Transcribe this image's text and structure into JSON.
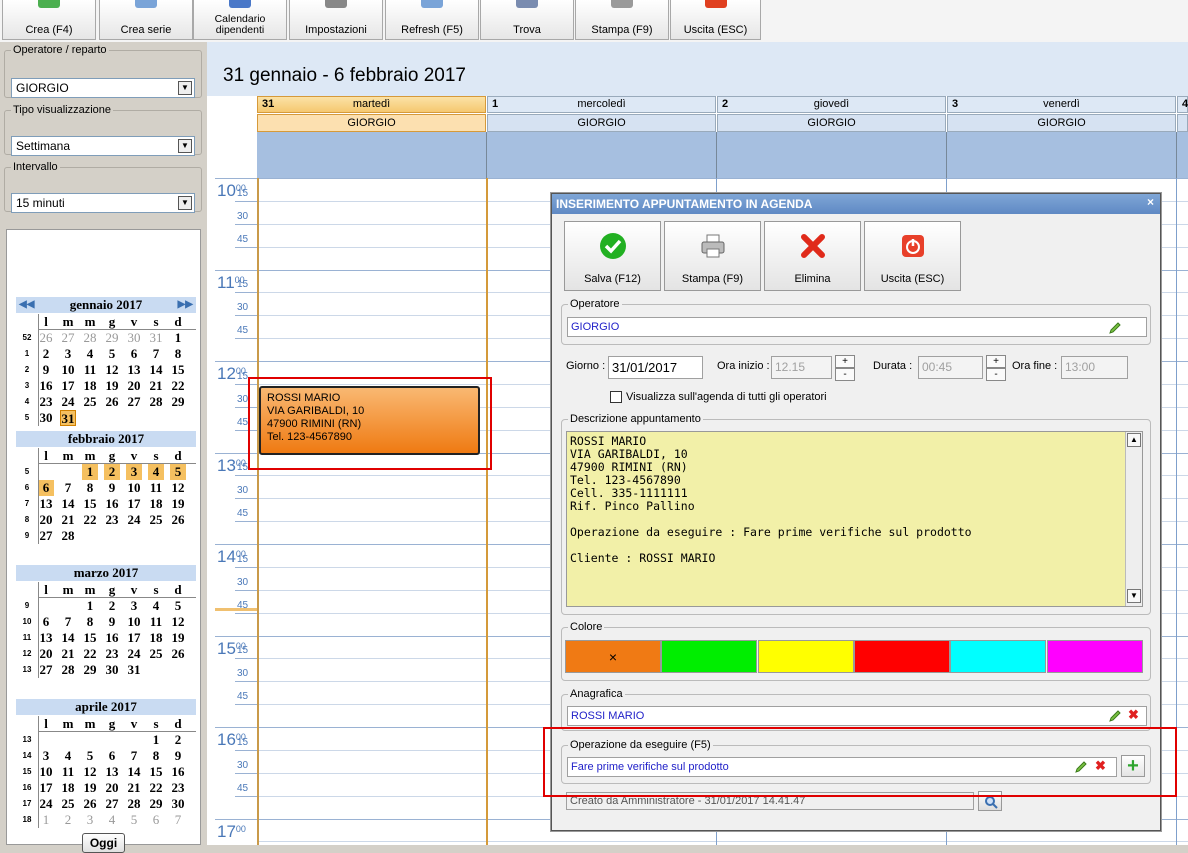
{
  "toolbar": {
    "buttons": [
      {
        "label": "Crea (F4)",
        "color": "#4caf50"
      },
      {
        "label": "Crea serie",
        "color": "#7aa4d8"
      },
      {
        "label": "Calendario dipendenti",
        "color": "#4a78c8"
      },
      {
        "label": "Impostazioni",
        "color": "#888888"
      },
      {
        "label": "Refresh (F5)",
        "color": "#7aa4d8"
      },
      {
        "label": "Trova",
        "color": "#7a8cb0"
      },
      {
        "label": "Stampa (F9)",
        "color": "#9a9a9a"
      },
      {
        "label": "Uscita (ESC)",
        "color": "#e04020"
      }
    ]
  },
  "left": {
    "operatore_label": "Operatore / reparto",
    "operatore_value": "GIORGIO",
    "tipo_label": "Tipo visualizzazione",
    "tipo_value": "Settimana",
    "intervallo_label": "Intervallo",
    "intervallo_value": "15 minuti",
    "dow": [
      "l",
      "m",
      "m",
      "g",
      "v",
      "s",
      "d"
    ],
    "months": [
      {
        "title": "gennaio 2017",
        "nav": true,
        "rows": [
          {
            "wk": "52",
            "days": [
              [
                "26",
                "g"
              ],
              [
                "27",
                "g"
              ],
              [
                "28",
                "g"
              ],
              [
                "29",
                "g"
              ],
              [
                "30",
                "g"
              ],
              [
                "31",
                "g"
              ],
              [
                "1",
                ""
              ]
            ]
          },
          {
            "wk": "1",
            "days": [
              [
                "2",
                ""
              ],
              [
                "3",
                ""
              ],
              [
                "4",
                ""
              ],
              [
                "5",
                ""
              ],
              [
                "6",
                ""
              ],
              [
                "7",
                ""
              ],
              [
                "8",
                ""
              ]
            ]
          },
          {
            "wk": "2",
            "days": [
              [
                "9",
                ""
              ],
              [
                "10",
                ""
              ],
              [
                "11",
                ""
              ],
              [
                "12",
                ""
              ],
              [
                "13",
                ""
              ],
              [
                "14",
                ""
              ],
              [
                "15",
                ""
              ]
            ]
          },
          {
            "wk": "3",
            "days": [
              [
                "16",
                ""
              ],
              [
                "17",
                ""
              ],
              [
                "18",
                ""
              ],
              [
                "19",
                ""
              ],
              [
                "20",
                ""
              ],
              [
                "21",
                ""
              ],
              [
                "22",
                ""
              ]
            ]
          },
          {
            "wk": "4",
            "days": [
              [
                "23",
                ""
              ],
              [
                "24",
                ""
              ],
              [
                "25",
                ""
              ],
              [
                "26",
                ""
              ],
              [
                "27",
                ""
              ],
              [
                "28",
                ""
              ],
              [
                "29",
                ""
              ]
            ]
          },
          {
            "wk": "5",
            "days": [
              [
                "30",
                ""
              ],
              [
                "31",
                "t"
              ],
              [
                "",
                ""
              ],
              [
                "",
                ""
              ],
              [
                "",
                ""
              ],
              [
                "",
                ""
              ],
              [
                "",
                ""
              ]
            ]
          }
        ]
      },
      {
        "title": "febbraio 2017",
        "nav": false,
        "rows": [
          {
            "wk": "5",
            "days": [
              [
                "",
                ""
              ],
              [
                "",
                ""
              ],
              [
                "1",
                "s"
              ],
              [
                "2",
                "s"
              ],
              [
                "3",
                "s"
              ],
              [
                "4",
                "s"
              ],
              [
                "5",
                "s"
              ]
            ]
          },
          {
            "wk": "6",
            "days": [
              [
                "6",
                "s"
              ],
              [
                "7",
                ""
              ],
              [
                "8",
                ""
              ],
              [
                "9",
                ""
              ],
              [
                "10",
                ""
              ],
              [
                "11",
                ""
              ],
              [
                "12",
                ""
              ]
            ]
          },
          {
            "wk": "7",
            "days": [
              [
                "13",
                ""
              ],
              [
                "14",
                ""
              ],
              [
                "15",
                ""
              ],
              [
                "16",
                ""
              ],
              [
                "17",
                ""
              ],
              [
                "18",
                ""
              ],
              [
                "19",
                ""
              ]
            ]
          },
          {
            "wk": "8",
            "days": [
              [
                "20",
                ""
              ],
              [
                "21",
                ""
              ],
              [
                "22",
                ""
              ],
              [
                "23",
                ""
              ],
              [
                "24",
                ""
              ],
              [
                "25",
                ""
              ],
              [
                "26",
                ""
              ]
            ]
          },
          {
            "wk": "9",
            "days": [
              [
                "27",
                ""
              ],
              [
                "28",
                ""
              ],
              [
                "",
                ""
              ],
              [
                "",
                ""
              ],
              [
                "",
                ""
              ],
              [
                "",
                ""
              ],
              [
                "",
                ""
              ]
            ]
          }
        ]
      },
      {
        "title": "marzo 2017",
        "nav": false,
        "rows": [
          {
            "wk": "9",
            "days": [
              [
                "",
                ""
              ],
              [
                "",
                ""
              ],
              [
                "1",
                ""
              ],
              [
                "2",
                ""
              ],
              [
                "3",
                ""
              ],
              [
                "4",
                ""
              ],
              [
                "5",
                ""
              ]
            ]
          },
          {
            "wk": "10",
            "days": [
              [
                "6",
                ""
              ],
              [
                "7",
                ""
              ],
              [
                "8",
                ""
              ],
              [
                "9",
                ""
              ],
              [
                "10",
                ""
              ],
              [
                "11",
                ""
              ],
              [
                "12",
                ""
              ]
            ]
          },
          {
            "wk": "11",
            "days": [
              [
                "13",
                ""
              ],
              [
                "14",
                ""
              ],
              [
                "15",
                ""
              ],
              [
                "16",
                ""
              ],
              [
                "17",
                ""
              ],
              [
                "18",
                ""
              ],
              [
                "19",
                ""
              ]
            ]
          },
          {
            "wk": "12",
            "days": [
              [
                "20",
                ""
              ],
              [
                "21",
                ""
              ],
              [
                "22",
                ""
              ],
              [
                "23",
                ""
              ],
              [
                "24",
                ""
              ],
              [
                "25",
                ""
              ],
              [
                "26",
                ""
              ]
            ]
          },
          {
            "wk": "13",
            "days": [
              [
                "27",
                ""
              ],
              [
                "28",
                ""
              ],
              [
                "29",
                ""
              ],
              [
                "30",
                ""
              ],
              [
                "31",
                ""
              ],
              [
                "",
                ""
              ],
              [
                "",
                ""
              ]
            ]
          }
        ]
      },
      {
        "title": "aprile 2017",
        "nav": false,
        "rows": [
          {
            "wk": "13",
            "days": [
              [
                "",
                ""
              ],
              [
                "",
                ""
              ],
              [
                "",
                ""
              ],
              [
                "",
                ""
              ],
              [
                "",
                ""
              ],
              [
                "1",
                ""
              ],
              [
                "2",
                ""
              ]
            ]
          },
          {
            "wk": "14",
            "days": [
              [
                "3",
                ""
              ],
              [
                "4",
                ""
              ],
              [
                "5",
                ""
              ],
              [
                "6",
                ""
              ],
              [
                "7",
                ""
              ],
              [
                "8",
                ""
              ],
              [
                "9",
                ""
              ]
            ]
          },
          {
            "wk": "15",
            "days": [
              [
                "10",
                ""
              ],
              [
                "11",
                ""
              ],
              [
                "12",
                ""
              ],
              [
                "13",
                ""
              ],
              [
                "14",
                ""
              ],
              [
                "15",
                ""
              ],
              [
                "16",
                ""
              ]
            ]
          },
          {
            "wk": "16",
            "days": [
              [
                "17",
                ""
              ],
              [
                "18",
                ""
              ],
              [
                "19",
                ""
              ],
              [
                "20",
                ""
              ],
              [
                "21",
                ""
              ],
              [
                "22",
                ""
              ],
              [
                "23",
                ""
              ]
            ]
          },
          {
            "wk": "17",
            "days": [
              [
                "24",
                ""
              ],
              [
                "25",
                ""
              ],
              [
                "26",
                ""
              ],
              [
                "27",
                ""
              ],
              [
                "28",
                ""
              ],
              [
                "29",
                ""
              ],
              [
                "30",
                ""
              ]
            ]
          },
          {
            "wk": "18",
            "days": [
              [
                "1",
                "g"
              ],
              [
                "2",
                "g"
              ],
              [
                "3",
                "g"
              ],
              [
                "4",
                "g"
              ],
              [
                "5",
                "g"
              ],
              [
                "6",
                "g"
              ],
              [
                "7",
                "g"
              ]
            ]
          }
        ]
      }
    ],
    "oggi": "Oggi"
  },
  "calendar": {
    "title": "31 gennaio - 6 febbraio 2017",
    "days": [
      {
        "num": "31",
        "name": "martedì",
        "operator": "GIORGIO"
      },
      {
        "num": "1",
        "name": "mercoledì",
        "operator": "GIORGIO"
      },
      {
        "num": "2",
        "name": "giovedì",
        "operator": "GIORGIO"
      },
      {
        "num": "3",
        "name": "venerdì",
        "operator": "GIORGIO"
      },
      {
        "num": "4",
        "name": "",
        "operator": ""
      }
    ],
    "hours": [
      "10",
      "11",
      "12",
      "13",
      "14",
      "15",
      "16",
      "17"
    ],
    "hour_sup": "00",
    "quarters": [
      "15",
      "30",
      "45"
    ],
    "appointment": [
      "ROSSI MARIO",
      "VIA GARIBALDI, 10",
      "47900 RIMINI (RN)",
      "Tel. 123-4567890"
    ]
  },
  "dialog": {
    "title": "INSERIMENTO APPUNTAMENTO IN AGENDA",
    "close": "×",
    "buttons": [
      "Salva (F12)",
      "Stampa (F9)",
      "Elimina",
      "Uscita (ESC)"
    ],
    "operatore_legend": "Operatore",
    "operatore_value": "GIORGIO",
    "giorno_label": "Giorno :",
    "giorno_value": "31/01/2017",
    "ora_inizio_label": "Ora inizio :",
    "ora_inizio_value": "12.15",
    "durata_label": "Durata :",
    "durata_value": "00:45",
    "ora_fine_label": "Ora fine :",
    "ora_fine_value": "13:00",
    "spin_plus": "+",
    "spin_minus": "-",
    "visualizza_label": "Visualizza sull'agenda di tutti gli operatori",
    "descrizione_legend": "Descrizione appuntamento",
    "descrizione_lines": [
      "ROSSI MARIO",
      "VIA GARIBALDI, 10",
      "47900 RIMINI (RN)",
      "Tel. 123-4567890",
      "Cell. 335-1111111",
      "Rif. Pinco Pallino",
      "",
      "Operazione da eseguire : Fare prime verifiche sul prodotto",
      "",
      "Cliente : ROSSI MARIO"
    ],
    "colore_legend": "Colore",
    "colors": [
      "#f07a14",
      "#00ee00",
      "#ffff00",
      "#ff0000",
      "#00ffff",
      "#ff00ff"
    ],
    "selected_color_mark": "×",
    "anagrafica_legend": "Anagrafica",
    "anagrafica_value": "ROSSI MARIO",
    "operazione_legend": "Operazione da eseguire (F5)",
    "operazione_value": "Fare prime verifiche sul prodotto",
    "creato": "Creato da Amministratore - 31/01/2017 14.41.47",
    "xmark": "✖",
    "plus_icon": "+"
  }
}
